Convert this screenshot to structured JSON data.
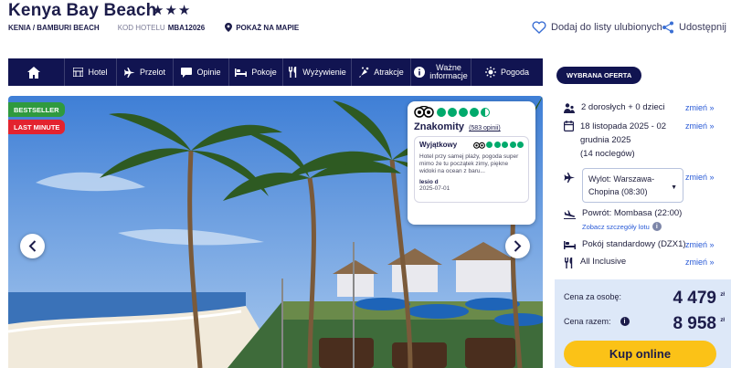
{
  "header": {
    "title": "Kenya Bay Beach",
    "stars": "★★★",
    "location": "KENIA / BAMBURI BEACH",
    "hotel_code_label": "KOD HOTELU",
    "hotel_code": "MBA12026",
    "map_link": "POKAŻ NA MAPIE",
    "favorites_label": "Dodaj do listy ulubionych",
    "share_label": "Udostępnij"
  },
  "nav": [
    {
      "label": "",
      "icon": "home-icon"
    },
    {
      "label": "Hotel",
      "icon": "hotel-icon"
    },
    {
      "label": "Przelot",
      "icon": "plane-icon"
    },
    {
      "label": "Opinie",
      "icon": "comment-icon"
    },
    {
      "label": "Pokoje",
      "icon": "bed-icon"
    },
    {
      "label": "Wyżywienie",
      "icon": "cutlery-icon"
    },
    {
      "label": "Atrakcje",
      "icon": "attractions-icon"
    },
    {
      "label_line1": "Ważne",
      "label_line2": "informacje",
      "icon": "info-icon"
    },
    {
      "label": "Pogoda",
      "icon": "sun-icon"
    }
  ],
  "gallery": {
    "badge_bestseller": "BESTSELLER",
    "badge_last_minute": "LAST MINUTE",
    "review": {
      "overall_rating": "Znakomity",
      "count": "(583 opinii)",
      "bubble_score": 4.5,
      "item_title": "Wyjątkowy",
      "item_text": "Hotel przy samej plaży, pogoda super mimo że tu początek zimy, piękne widoki na ocean z baru...",
      "author": "lesio d",
      "date": "2025-07-01",
      "item_score": 5
    }
  },
  "offer": {
    "pill_label": "WYBRANA OFERTA",
    "guests": "2 dorosłych + 0 dzieci",
    "dates_line1": "18 listopada 2025 - 02",
    "dates_line2": "grudnia 2025",
    "nights": "(14 noclegów)",
    "departure_line1": "Wylot: Warszawa-",
    "departure_line2": "Chopina (08:30)",
    "return": "Powrót: Mombasa (22:00)",
    "flight_details": "Zobacz szczegóły lotu",
    "room": "Pokój standardowy (DZX1)",
    "board": "All Inclusive",
    "change_label": "zmień »"
  },
  "price": {
    "per_person_label": "Cena za osobę:",
    "per_person_value": "4 479",
    "total_label": "Cena razem:",
    "total_value": "8 958",
    "currency": "zł",
    "buy_label": "Kup online"
  },
  "colors": {
    "navy": "#111451",
    "accent_yellow": "#fbc217",
    "link_blue": "#2a5bd7",
    "tripadvisor_green": "#00aa6c",
    "bestseller_green": "#2f9a3e",
    "last_minute_red": "#e3232f"
  }
}
